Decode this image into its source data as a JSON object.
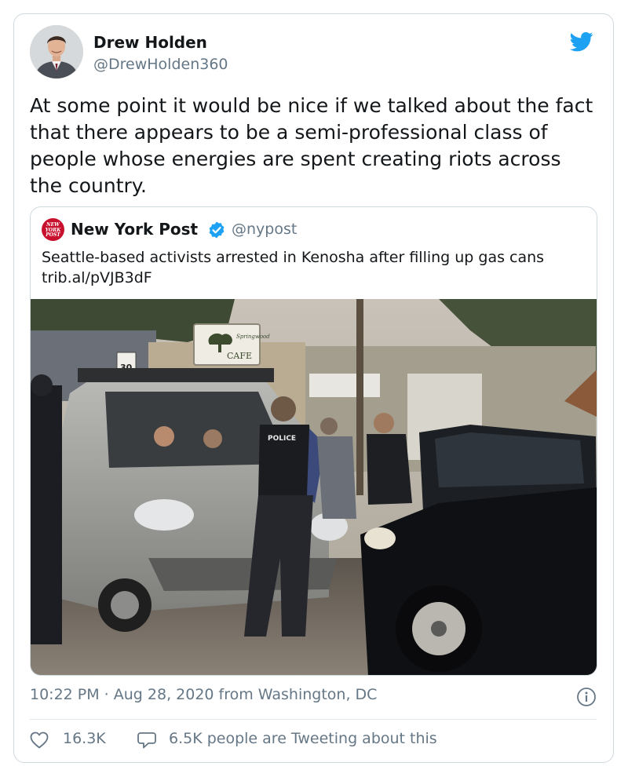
{
  "author": {
    "name": "Drew Holden",
    "handle": "@DrewHolden360",
    "avatar_icon": "user-avatar"
  },
  "tweet": {
    "text": "At some point it would be nice if we talked about the fact that there appears to be a semi-professional class of people whose energies are spent creating riots across the country."
  },
  "quoted_tweet": {
    "logo_text": "NEW YORK POST",
    "name": "New York Post",
    "verified": true,
    "handle": "@nypost",
    "text": "Seattle-based activists arrested in Kenosha after filling up gas cans trib.al/pVJB3dF",
    "image_signs": {
      "cafe_sign_top": "Springwood",
      "cafe_sign_bottom": "CAFE",
      "speed_sign": "30",
      "vest_text": "POLICE"
    }
  },
  "meta": {
    "timestamp": "10:22 PM · Aug 28, 2020 from Washington, DC"
  },
  "engagement": {
    "likes": "16.3K",
    "people_tweeting": "6.5K people are Tweeting about this"
  },
  "colors": {
    "twitter_blue": "#1da1f2",
    "text_primary": "#14171a",
    "text_secondary": "#657786",
    "border": "#cfd9de",
    "nypost_red": "#c8102e"
  },
  "icons": [
    "twitter-bird-icon",
    "verified-badge-icon",
    "info-icon",
    "heart-icon",
    "reply-bubble-icon"
  ]
}
